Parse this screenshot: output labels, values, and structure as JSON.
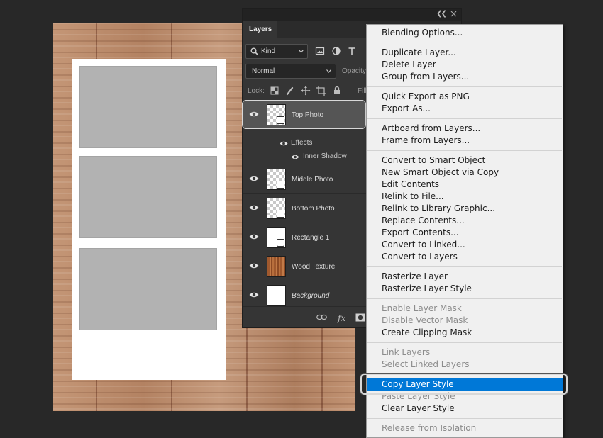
{
  "panel": {
    "tab_label": "Layers",
    "kind_label": "Kind",
    "blend_mode": "Normal",
    "opacity_label": "Opacity:",
    "lock_label": "Lock:",
    "fill_label": "Fill:"
  },
  "layers": [
    {
      "name": "Top Photo",
      "thumb": "smart-object-thumb",
      "selected": true
    },
    {
      "effects_label": "Effects",
      "effect_name": "Inner Shadow"
    },
    {
      "name": "Middle Photo",
      "thumb": "smart-object-thumb"
    },
    {
      "name": "Bottom Photo",
      "thumb": "smart-object-thumb"
    },
    {
      "name": "Rectangle 1",
      "thumb": "shape-thumb"
    },
    {
      "name": "Wood Texture",
      "thumb": "wood-thumb"
    },
    {
      "name": "Background",
      "thumb": "white-thumb"
    }
  ],
  "menu": {
    "items": [
      "Blending Options...",
      "Duplicate Layer...",
      "Delete Layer",
      "Group from Layers...",
      "Quick Export as PNG",
      "Export As...",
      "Artboard from Layers...",
      "Frame from Layers...",
      "Convert to Smart Object",
      "New Smart Object via Copy",
      "Edit Contents",
      "Relink to File...",
      "Relink to Library Graphic...",
      "Replace Contents...",
      "Export Contents...",
      "Convert to Linked...",
      "Convert to Layers",
      "Rasterize Layer",
      "Rasterize Layer Style",
      "Enable Layer Mask",
      "Disable Vector Mask",
      "Create Clipping Mask",
      "Link Layers",
      "Select Linked Layers",
      "Copy Layer Style",
      "Paste Layer Style",
      "Clear Layer Style",
      "Release from Isolation"
    ]
  },
  "colors": {
    "menu_highlight": "#0078d7",
    "panel_bg": "#353535",
    "app_bg": "#282828"
  }
}
